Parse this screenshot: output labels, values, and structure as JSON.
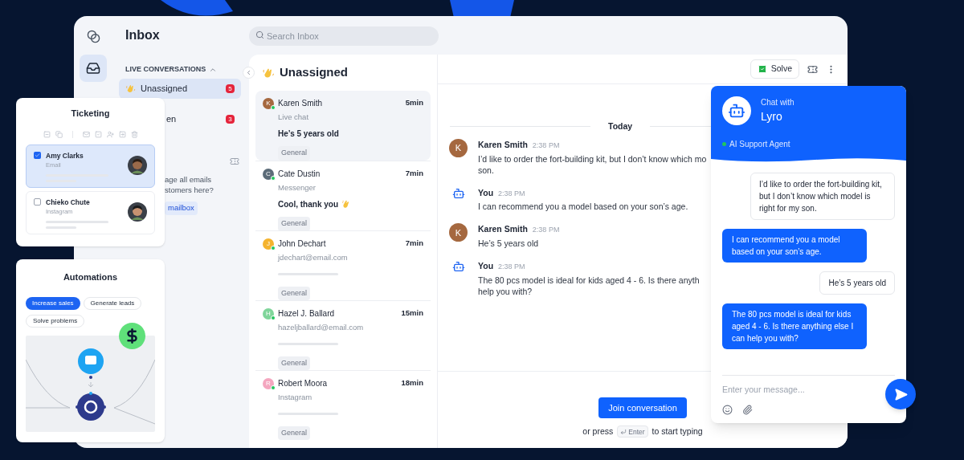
{
  "inbox": {
    "title": "Inbox",
    "search": {
      "placeholder": "Search Inbox"
    }
  },
  "sidebar": {
    "section": "LIVE CONVERSATIONS",
    "expanded": true,
    "items": [
      {
        "label": "Unassigned",
        "count": "5",
        "selected": true
      },
      {
        "label": "en",
        "count": "3",
        "selected": false
      }
    ],
    "prompt_lines": [
      "age all emails",
      "stomers here?"
    ],
    "prompt_button": "mailbox"
  },
  "list": {
    "title": "Unassigned",
    "items": [
      {
        "name": "Karen Smith",
        "initial": "K",
        "color": "#a5683f",
        "online": true,
        "time": "5min",
        "channel": "Live chat",
        "preview": "He’s 5 years old",
        "tag": "General",
        "selected": true
      },
      {
        "name": "Cate Dustin",
        "initial": "C",
        "color": "#5b6b78",
        "online": true,
        "time": "7min",
        "channel": "Messenger",
        "preview": "Cool, thank you",
        "clap": true,
        "tag": "General",
        "selected": false
      },
      {
        "name": "John Dechart",
        "initial": "J",
        "color": "#f4b32e",
        "online": true,
        "time": "7min",
        "channel": "jdechart@email.com",
        "tag": "General",
        "selected": false
      },
      {
        "name": "Hazel J. Ballard",
        "initial": "H",
        "color": "#7fd59a",
        "online": true,
        "time": "15min",
        "channel": "hazeljballard@email.com",
        "tag": "General",
        "selected": false
      },
      {
        "name": "Robert Moora",
        "initial": "R",
        "color": "#f4a6bf",
        "online": true,
        "time": "18min",
        "channel": "Instagram",
        "tag": "General",
        "selected": false
      }
    ]
  },
  "conversation": {
    "solve": "Solve",
    "date": "Today",
    "messages": [
      {
        "kind": "customer",
        "author": "Karen Smith",
        "initial": "K",
        "time": "2:38 PM",
        "lines": [
          "I’d like to order the fort-building kit, but I don’t know which mo",
          "son."
        ]
      },
      {
        "kind": "agent",
        "author": "You",
        "time": "2:38 PM",
        "lines": [
          "I can recommend you a model based on your son’s age."
        ]
      },
      {
        "kind": "customer",
        "author": "Karen Smith",
        "initial": "K",
        "time": "2:38 PM",
        "lines": [
          "He’s 5 years old"
        ]
      },
      {
        "kind": "agent",
        "author": "You",
        "time": "2:38 PM",
        "lines": [
          "The 80 pcs model is ideal for kids aged 4 - 6. Is there anyth",
          "help you with?"
        ]
      }
    ],
    "join_button": "Join conversation",
    "hint_before": "or press",
    "hint_key": "Enter",
    "hint_after": "to start typing"
  },
  "widget": {
    "subtitle": "Chat with",
    "title": "Lyro",
    "status": "AI Support Agent",
    "online": true,
    "messages": [
      {
        "kind": "user",
        "text": "I’d like to order the fort-building kit, but I don’t know which model is right for my son."
      },
      {
        "kind": "bot",
        "text": "I can recommend you a model based on your son’s age."
      },
      {
        "kind": "user",
        "text": "He’s 5 years old"
      },
      {
        "kind": "bot",
        "text": "The 80 pcs model is ideal for kids aged 4 - 6. Is there anything else I can help you with?"
      }
    ],
    "input": {
      "placeholder": "Enter your message..."
    }
  },
  "ticketing": {
    "title": "Ticketing",
    "tickets": [
      {
        "name": "Amy Clarks",
        "channel": "Email",
        "checked": true
      },
      {
        "name": "Chieko Chute",
        "channel": "Instagram",
        "checked": false
      }
    ]
  },
  "automations": {
    "title": "Automations",
    "chips": [
      {
        "label": "Increase sales",
        "selected": true
      },
      {
        "label": "Generate leads",
        "selected": false
      },
      {
        "label": "Solve problems",
        "selected": false
      }
    ]
  }
}
